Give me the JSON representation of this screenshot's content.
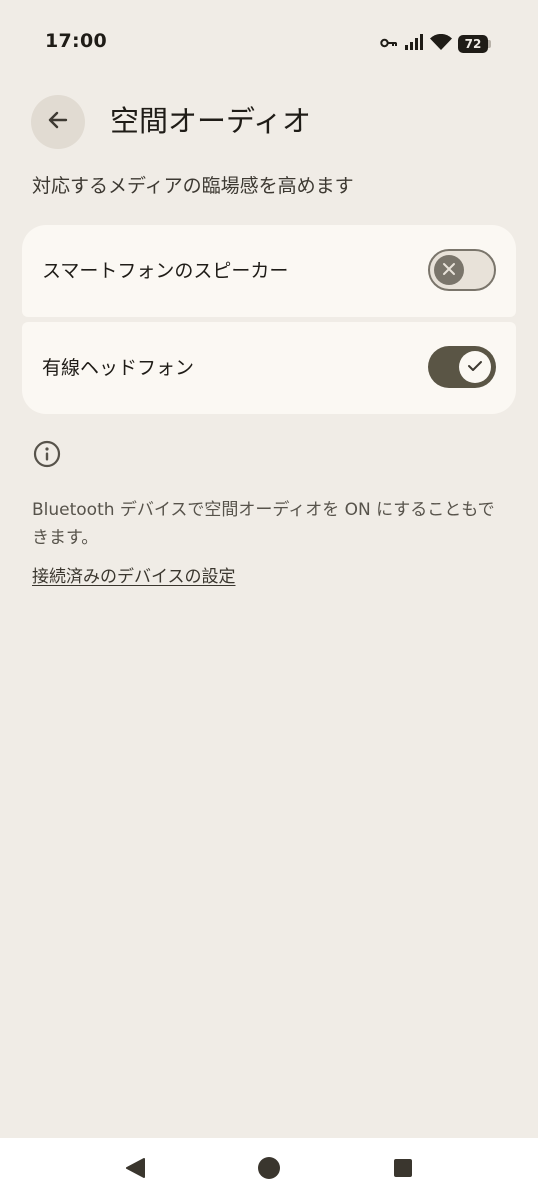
{
  "status_bar": {
    "time": "17:00",
    "battery": "72",
    "icons": [
      "vpn-key-icon",
      "signal-icon",
      "wifi-icon",
      "battery-icon"
    ]
  },
  "header": {
    "back_icon": "arrow-back-icon",
    "title": "空間オーディオ"
  },
  "subtitle": "対応するメディアの臨場感を高めます",
  "settings": [
    {
      "label": "スマートフォンのスピーカー",
      "enabled": false
    },
    {
      "label": "有線ヘッドフォン",
      "enabled": true
    }
  ],
  "info": {
    "icon": "info-icon",
    "text": "Bluetooth デバイスで空間オーディオを ON にすることもできます。",
    "link": "接続済みのデバイスの設定"
  },
  "nav_bar": {
    "buttons": [
      "back-triangle-icon",
      "home-circle-icon",
      "recents-square-icon"
    ]
  },
  "colors": {
    "background": "#f0ece6",
    "card": "#fbf8f3",
    "switch_on": "#5a5545",
    "switch_off_outline": "#7a756b"
  }
}
